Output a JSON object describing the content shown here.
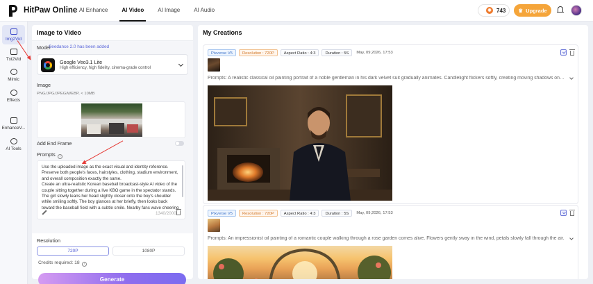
{
  "brand": {
    "name": "HitPaw Online"
  },
  "topnav": {
    "tabs": [
      {
        "label": "AI Enhance",
        "active": false
      },
      {
        "label": "AI Video",
        "active": true
      },
      {
        "label": "AI Image",
        "active": false
      },
      {
        "label": "AI Audio",
        "active": false
      }
    ],
    "credits": "743",
    "upgrade_label": "Upgrade"
  },
  "sidebar": {
    "items": [
      {
        "label": "Img2Vid",
        "icon": "image-video-icon",
        "active": true
      },
      {
        "label": "Txt2Vid",
        "icon": "text-video-icon",
        "active": false
      },
      {
        "label": "Mimic",
        "icon": "mimic-icon",
        "active": false
      },
      {
        "label": "Effects",
        "icon": "effects-icon",
        "active": false
      },
      {
        "label": "EnhanceV...",
        "icon": "enhance-video-icon",
        "active": false
      },
      {
        "label": "AI Tools",
        "icon": "ai-tools-icon",
        "active": false
      }
    ]
  },
  "left_panel": {
    "title": "Image to Video",
    "model_label": "Model",
    "model_notice": "Seedance 2.0 has been added",
    "model": {
      "name": "Google Veo3.1 Lite",
      "description": "High efficiency, high fidelity, cinema-grade control"
    },
    "image_label": "Image",
    "image_hint": "PNG/JPG/JPEG/WEBP, < 10MB",
    "add_end_frame_label": "Add End Frame",
    "prompts_label": "Prompts",
    "prompt_text": "Use the uploaded image as the exact visual and identity reference. Preserve both people's faces, hairstyles, clothing, stadium environment, and overall composition exactly the same.\nCreate an ultra-realistic Korean baseball broadcast-style AI video of the couple sitting together during a live KBO game in the spectator stands. The girl slowly leans her head slightly closer onto the boy's shoulder while smiling softly. The boy glances at her briefly, then looks back toward the baseball field with a subtle smile. Nearby fans wave cheering",
    "char_count": "1340/2000",
    "resolution_label": "Resolution",
    "resolutions": [
      {
        "label": "720P",
        "active": true
      },
      {
        "label": "1080P",
        "active": false
      }
    ],
    "credits_required": "Credits required: 18",
    "generate_label": "Generate"
  },
  "right_panel": {
    "title": "My Creations",
    "creations": [
      {
        "tags": [
          "Pixverse V5",
          "Resolution : 720P",
          "Aspect Ratio : 4:3",
          "Duration : 5S"
        ],
        "date": "May, 09,2026, 17:53",
        "prompt": "Prompts: A realistic classical oil painting portrait of a noble gentleman in his dark velvet suit gradually animates. Candlelight flickers softly, creating moving shadows on the walls."
      },
      {
        "tags": [
          "Pixverse V5",
          "Resolution : 720P",
          "Aspect Ratio : 4:3",
          "Duration : 5S"
        ],
        "date": "May, 09,2026, 17:53",
        "prompt": "Prompts: An impressionist oil painting of a romantic couple walking through a rose garden comes alive. Flowers gently sway in the wind, petals slowly fall through the air."
      }
    ]
  },
  "colors": {
    "accent": "#3b48c7",
    "upgrade": "#f5a53a",
    "annotation_arrow": "#e53935",
    "generate_gradient_start": "#d59bf1",
    "generate_gradient_end": "#7b6cf0"
  }
}
